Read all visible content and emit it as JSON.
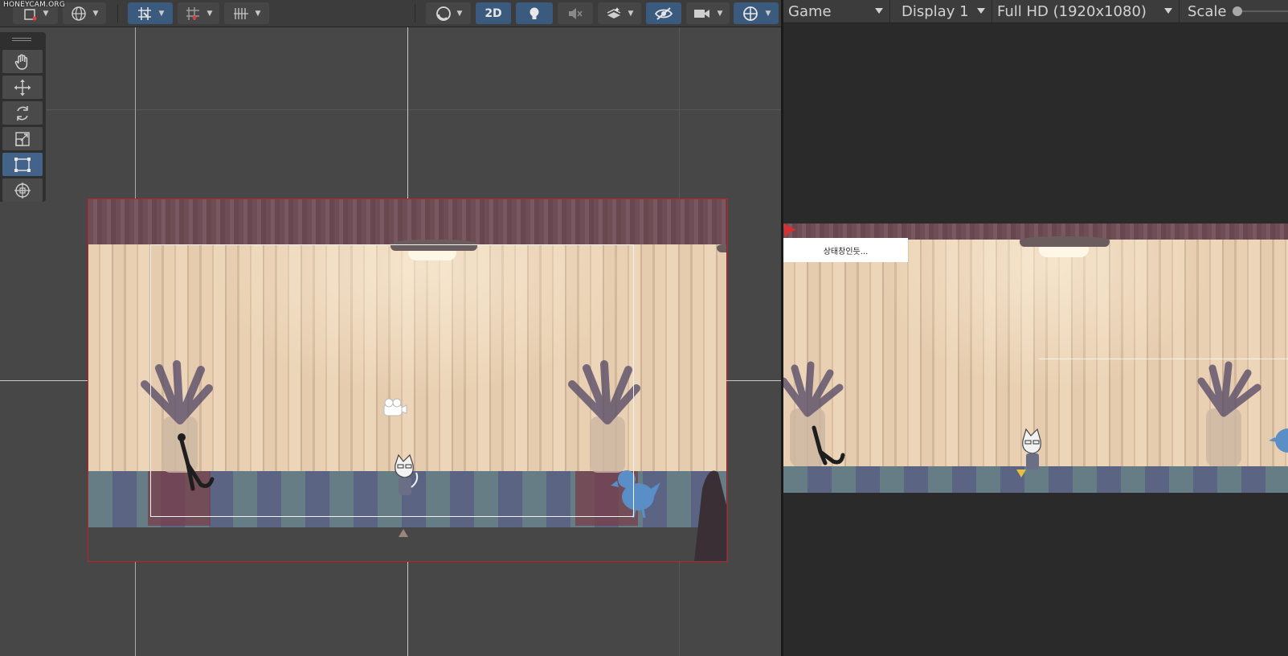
{
  "watermark": "HONEYCAM.ORG",
  "scene_toolbar": {
    "items": [
      {
        "icon": "transform-tools-icon",
        "active": false
      },
      {
        "icon": "global-pivot-icon",
        "active": false
      },
      {
        "icon": "grid-snap-icon",
        "active": true
      },
      {
        "icon": "increment-snap-icon",
        "active": false
      },
      {
        "icon": "grid-visibility-icon",
        "active": false
      },
      {
        "icon": "draw-mode-icon",
        "active": false
      },
      {
        "icon": "2d-toggle",
        "label": "2D",
        "active": true
      },
      {
        "icon": "lighting-icon",
        "active": true
      },
      {
        "icon": "audio-mute-icon",
        "active": false
      },
      {
        "icon": "effects-icon",
        "active": false
      },
      {
        "icon": "hidden-objects-icon",
        "active": true
      },
      {
        "icon": "scene-camera-icon",
        "active": false
      },
      {
        "icon": "gizmos-icon",
        "active": true
      }
    ],
    "label_2d": "2D"
  },
  "tools": [
    {
      "name": "hand-tool",
      "icon": "hand-icon",
      "selected": false
    },
    {
      "name": "move-tool",
      "icon": "move-arrows-icon",
      "selected": false
    },
    {
      "name": "rotate-tool",
      "icon": "rotate-icon",
      "selected": false
    },
    {
      "name": "scale-tool",
      "icon": "scale-icon",
      "selected": false
    },
    {
      "name": "rect-tool",
      "icon": "rect-transform-icon",
      "selected": true
    },
    {
      "name": "transform-tool",
      "icon": "transform-icon",
      "selected": false
    }
  ],
  "game_header": {
    "view_label": "Game",
    "display_label": "Display 1",
    "resolution_label": "Full HD (1920x1080)",
    "scale_label": "Scale"
  },
  "game_view": {
    "status_text": "상태창인듯..."
  },
  "colors": {
    "camera_frame": "#c41e27",
    "active_button": "#3a5a7e",
    "scene_background": "#474747",
    "game_background": "#2a2a2a",
    "curtain": "#6e4d55",
    "wall": "#e9d0b2",
    "floor": "#5b5f7d",
    "bird": "#5a8ec6"
  }
}
